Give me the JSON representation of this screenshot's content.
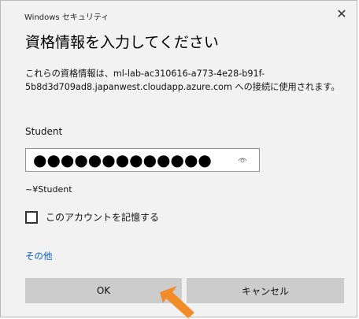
{
  "window": {
    "app_title": "Windows セキュリティ",
    "close_glyph": "✕"
  },
  "dialog": {
    "heading": "資格情報を入力してください",
    "description": "これらの資格情報は、ml-lab-ac310616-a773-4e28-b91f-5b8d3d709ad8.japanwest.cloudapp.azure.com への接続に使用されます。",
    "username_label": "Student",
    "password": {
      "masked_value": "●●●●●●●●●●●●●",
      "reveal_icon": "eye-icon"
    },
    "domain_label": "~¥Student",
    "remember_checkbox": {
      "label": "このアカウントを記憶する",
      "checked": false
    },
    "more_link": "その他",
    "buttons": {
      "ok": "OK",
      "cancel": "キャンセル"
    }
  },
  "annotation": {
    "arrow_color": "#f28c28"
  }
}
